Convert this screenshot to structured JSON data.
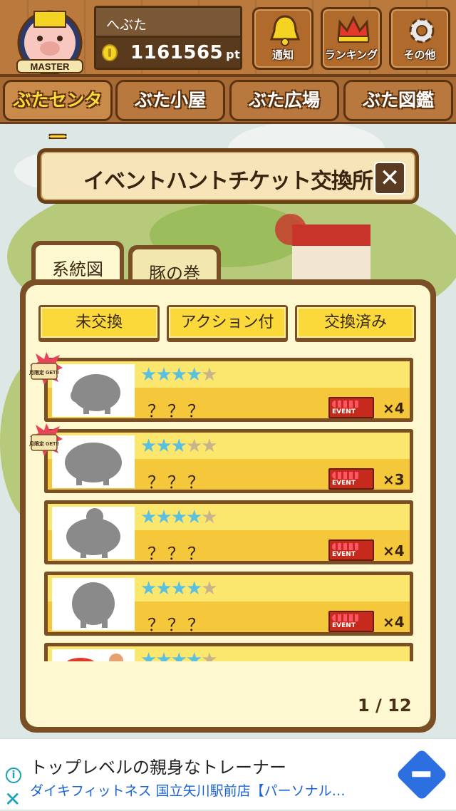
{
  "header": {
    "rank_badge": "MASTER",
    "player_name": "へぶた",
    "points": "1161565",
    "points_unit": "pt",
    "buttons": [
      {
        "label": "通知",
        "icon": "bell-icon"
      },
      {
        "label": "ランキング",
        "icon": "crown-icon"
      },
      {
        "label": "その他",
        "icon": "gear-icon"
      }
    ]
  },
  "nav_tabs": [
    "ぶたセンター",
    "ぶた小屋",
    "ぶた広場",
    "ぶた図鑑"
  ],
  "dialog": {
    "title": "イベントハントチケット交換所",
    "close": "✕",
    "panel_tabs": [
      "系統図",
      "豚の巻"
    ],
    "filters": [
      "未交換",
      "アクション付",
      "交換済み"
    ],
    "items": [
      {
        "stars": 4,
        "max_stars": 5,
        "name": "？？？",
        "count": "×4",
        "monthly_badge": "月限定 GET!!",
        "event_label": "EVENT"
      },
      {
        "stars": 3,
        "max_stars": 5,
        "name": "？？？",
        "count": "×3",
        "monthly_badge": "月限定 GET!!",
        "event_label": "EVENT"
      },
      {
        "stars": 4,
        "max_stars": 5,
        "name": "？？？",
        "count": "×4",
        "monthly_badge": "",
        "event_label": "EVENT"
      },
      {
        "stars": 4,
        "max_stars": 5,
        "name": "？？？",
        "count": "×4",
        "monthly_badge": "",
        "event_label": "EVENT"
      },
      {
        "stars": 4,
        "max_stars": 5,
        "name": "",
        "count": "",
        "monthly_badge": "",
        "event_label": ""
      }
    ],
    "pager": "1 / 12"
  },
  "ad": {
    "headline": "トップレベルの親身なトレーナー",
    "subline": "ダイキフィットネス 国立矢川駅前店【パーソナル…"
  },
  "colors": {
    "star_on": "#5bbfe0",
    "star_off": "#c8b48a",
    "accent_yellow": "#fbd93a",
    "wood": "#ba7a3e"
  }
}
